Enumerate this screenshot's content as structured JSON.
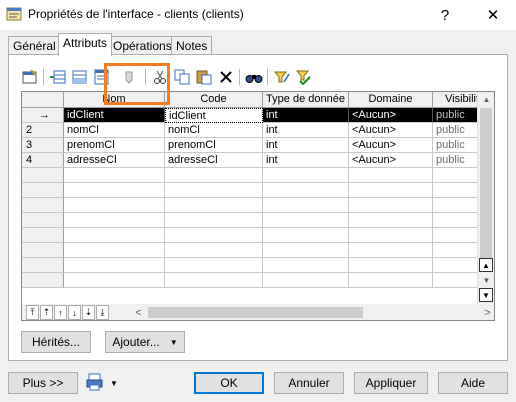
{
  "window": {
    "title": "Propriétés de l'interface - clients (clients)",
    "help_label": "?",
    "close_label": "✕"
  },
  "tabs": [
    {
      "label": "Général",
      "active": false
    },
    {
      "label": "Attributs",
      "active": true
    },
    {
      "label": "Opérations",
      "active": false
    },
    {
      "label": "Notes",
      "active": false
    }
  ],
  "toolbar": {
    "icons": [
      "properties-icon",
      "insert-row-icon",
      "add-row-icon",
      "add-attributes-icon",
      "filter-icon",
      "cut-icon",
      "copy-icon",
      "paste-icon",
      "delete-icon",
      "find-icon",
      "filter-funnel-icon",
      "check-filter-icon"
    ]
  },
  "grid": {
    "columns": [
      "",
      "Nom",
      "Code",
      "Type de donnée",
      "Domaine",
      "Visibilité"
    ],
    "rows": [
      {
        "num": "→",
        "nom": "idClient",
        "code": "idClient",
        "type": "int",
        "domaine": "<Aucun>",
        "visibilite": "public",
        "selected": true
      },
      {
        "num": "2",
        "nom": "nomCl",
        "code": "nomCl",
        "type": "int",
        "domaine": "<Aucun>",
        "visibilite": "public",
        "selected": false
      },
      {
        "num": "3",
        "nom": "prenomCl",
        "code": "prenomCl",
        "type": "int",
        "domaine": "<Aucun>",
        "visibilite": "public",
        "selected": false
      },
      {
        "num": "4",
        "nom": "adresseCl",
        "code": "adresseCl",
        "type": "int",
        "domaine": "<Aucun>",
        "visibilite": "public",
        "selected": false
      }
    ],
    "nav_buttons": [
      "⤒",
      "⇡",
      "↑",
      "↓",
      "⇣",
      "⤓"
    ],
    "scroll_left": "<",
    "scroll_right": ">"
  },
  "actions": {
    "herites_label": "Hérités...",
    "ajouter_label": "Ajouter...",
    "ajouter_arrow": "▼"
  },
  "footer": {
    "plus_label": "Plus >>",
    "print_arrow": "▼",
    "ok_label": "OK",
    "annuler_label": "Annuler",
    "appliquer_label": "Appliquer",
    "aide_label": "Aide"
  },
  "colors": {
    "accent": "#0078d7",
    "highlight": "#f57c1f",
    "selection": "#000000"
  }
}
